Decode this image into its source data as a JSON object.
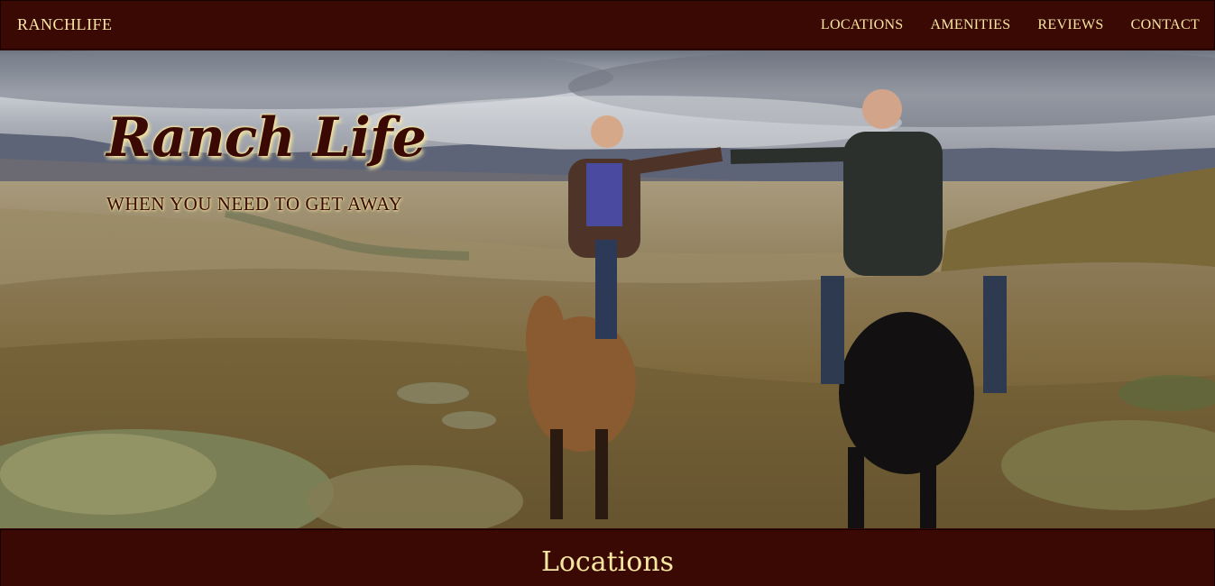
{
  "navbar": {
    "brand": "RANCHLIFE",
    "links": [
      "LOCATIONS",
      "AMENITIES",
      "REVIEWS",
      "CONTACT"
    ]
  },
  "hero": {
    "title": "Ranch Life",
    "subtitle": "WHEN YOU NEED TO GET AWAY",
    "image_description_icon": "hero-photo"
  },
  "sections": {
    "locations_title": "Locations"
  },
  "colors": {
    "primary": "#3a0904",
    "accent": "#f7e7a1"
  }
}
